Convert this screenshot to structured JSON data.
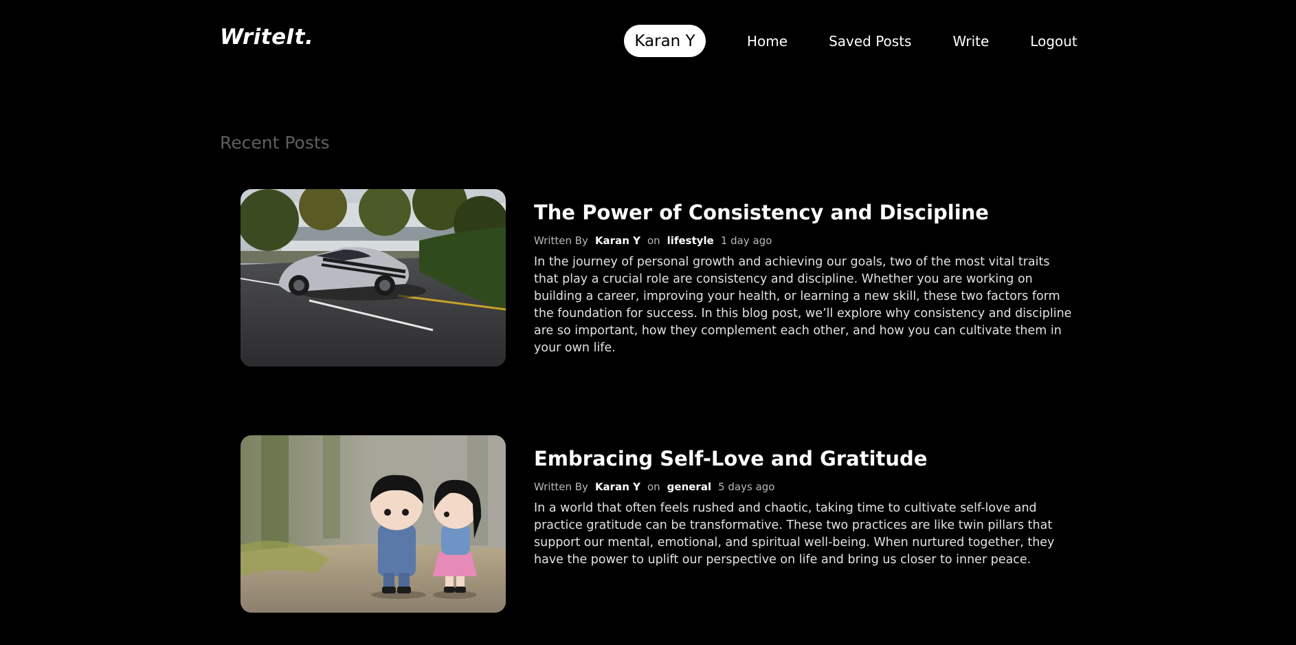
{
  "header": {
    "logo": "WriteIt.",
    "user_name": "Karan Y",
    "nav": {
      "home": "Home",
      "saved": "Saved Posts",
      "write": "Write",
      "logout": "Logout"
    }
  },
  "section_title": "Recent Posts",
  "posts": [
    {
      "title": "The Power of Consistency and Discipline",
      "written_by": "Written By",
      "author": "Karan Y",
      "on": "on",
      "category": "lifestyle",
      "time": "1 day ago",
      "excerpt": "In the journey of personal growth and achieving our goals, two of the most vital traits that play a crucial role are consistency and discipline. Whether you are working on building a career, improving your health, or learning a new skill, these two factors form the foundation for success. In this blog post, we’ll explore why consistency and discipline are so important, how they complement each other, and how you can cultivate them in your own life.",
      "image": "silver-sports-car-photo"
    },
    {
      "title": "Embracing Self-Love and Gratitude",
      "written_by": "Written By",
      "author": "Karan Y",
      "on": "on",
      "category": "general",
      "time": "5 days ago",
      "excerpt": "In a world that often feels rushed and chaotic, taking time to cultivate self-love and practice gratitude can be transformative. These two practices are like twin pillars that support our mental, emotional, and spiritual well-being. When nurtured together, they have the power to uplift our perspective on life and bring us closer to inner peace.",
      "image": "couple-figurines-photo"
    }
  ],
  "colors": {
    "background": "#000000",
    "text": "#ffffff",
    "muted": "#5f5f5f",
    "pill_bg": "#ffffff",
    "pill_text": "#000000"
  }
}
